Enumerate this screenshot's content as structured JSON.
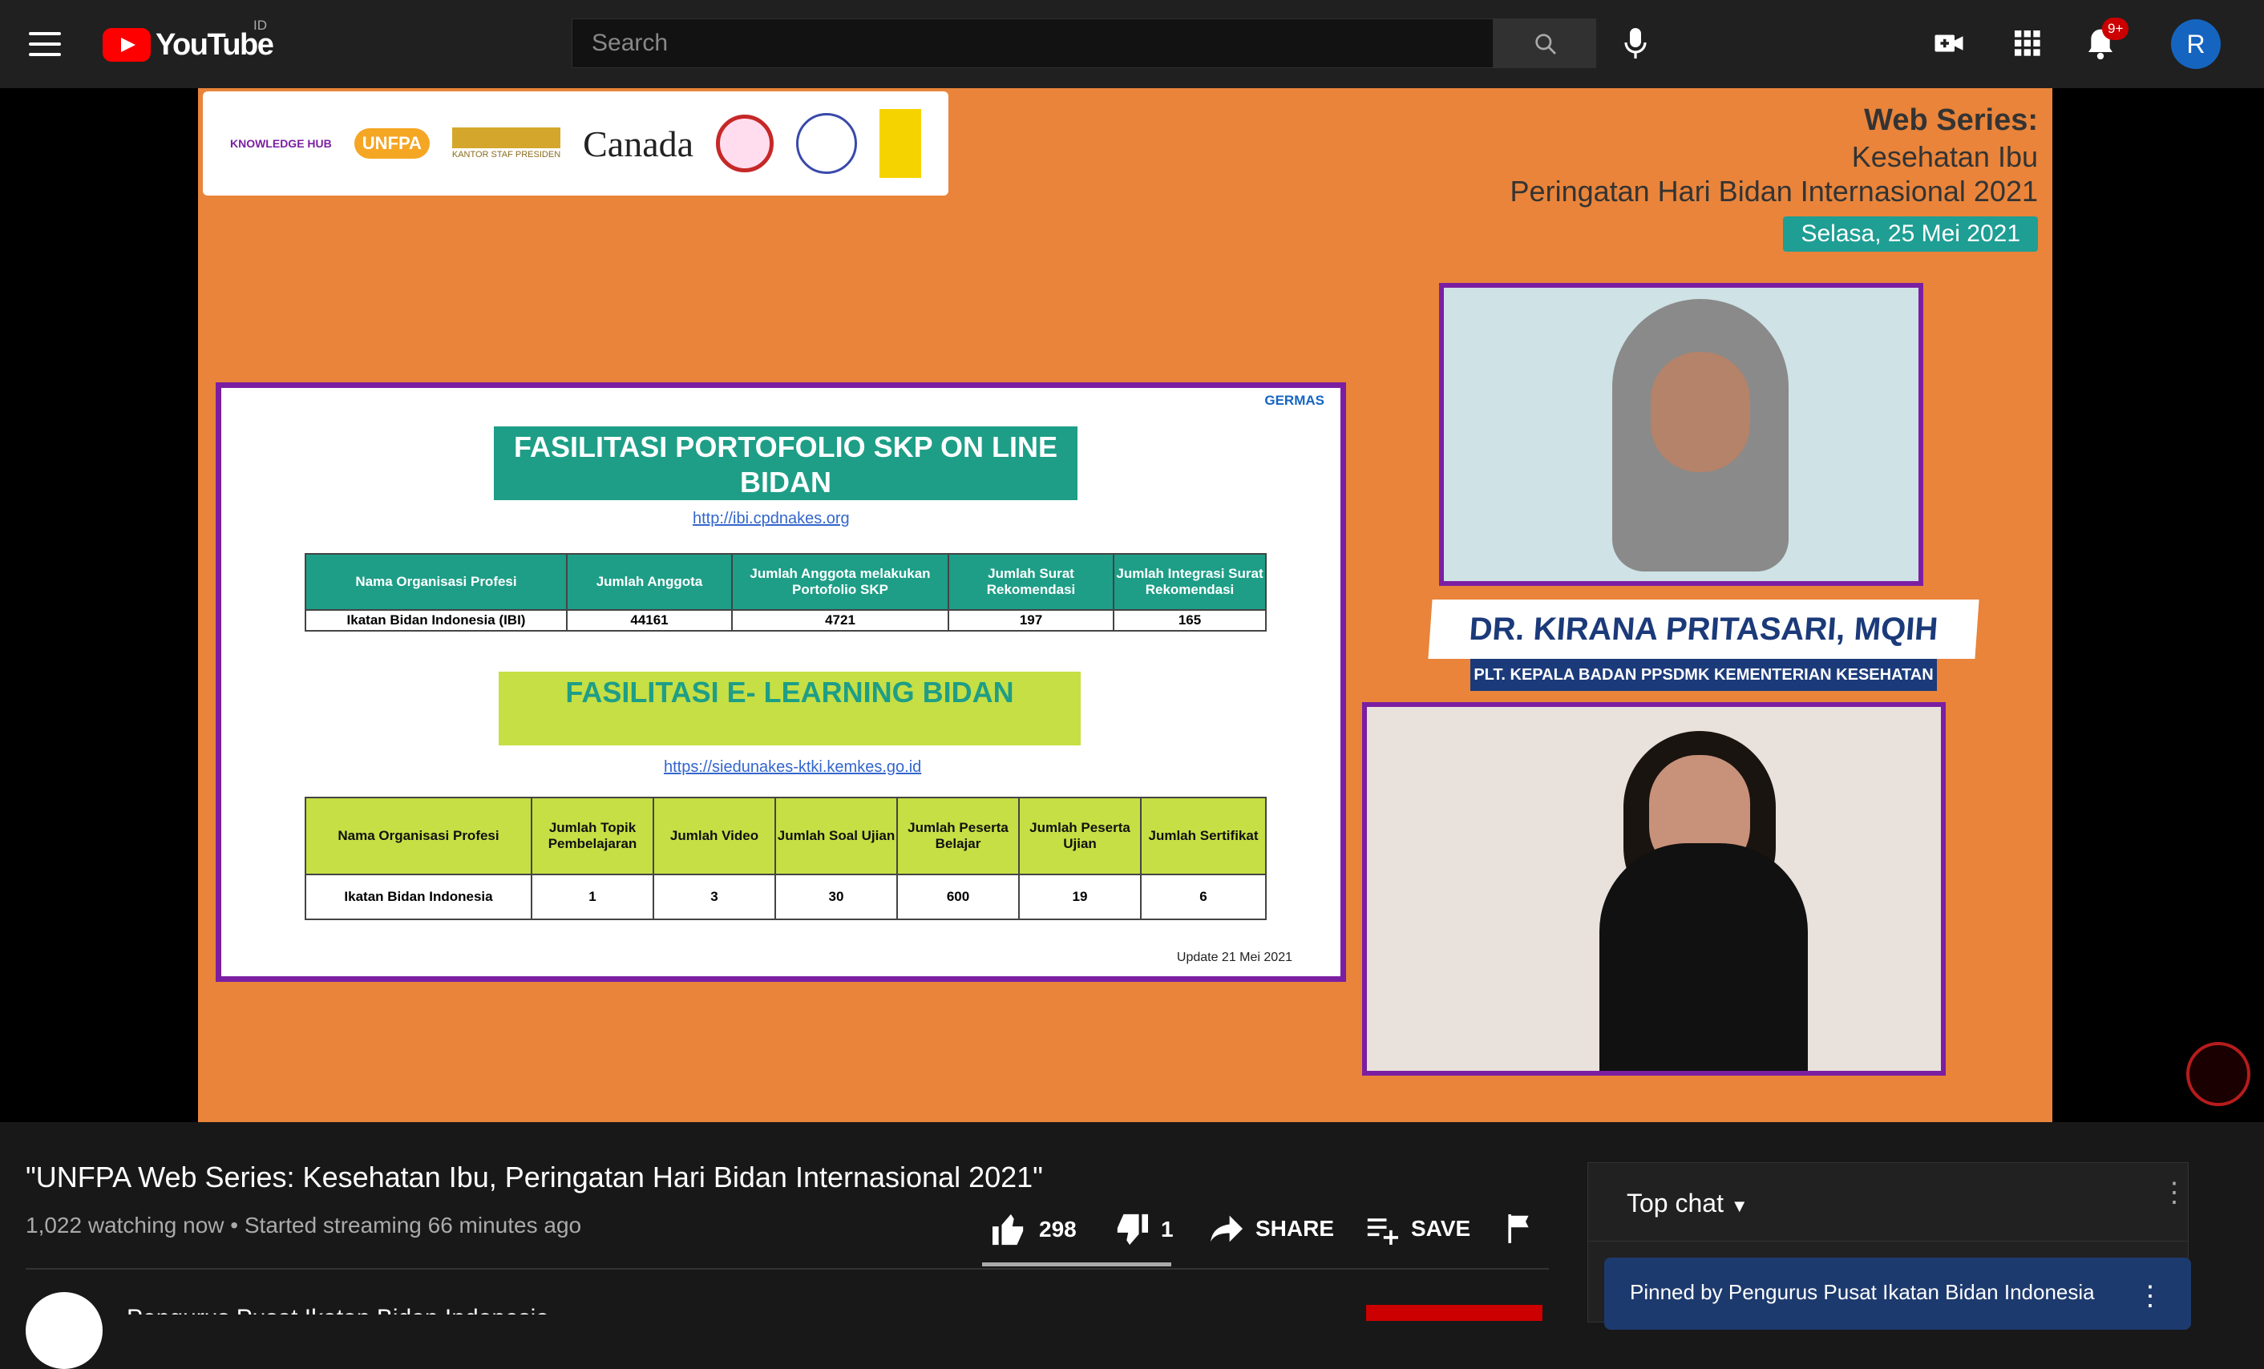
{
  "header": {
    "logo_text": "YouTube",
    "country_code": "ID",
    "search_placeholder": "Search",
    "notification_count": "9+",
    "avatar_letter": "R"
  },
  "video_frame": {
    "series_title": "Web Series:",
    "series_subtitle": "Kesehatan Ibu",
    "series_event": "Peringatan Hari Bidan Internasional 2021",
    "date": "Selasa, 25 Mei 2021",
    "partner_logos": [
      "KNOWLEDGE HUB",
      "UNFPA",
      "KANTOR STAF PRESIDEN",
      "Canada"
    ],
    "slide": {
      "heading1": "FASILITASI PORTOFOLIO SKP ON LINE BIDAN",
      "link1": "http://ibi.cpdnakes.org",
      "table1_headers": [
        "Nama Organisasi Profesi",
        "Jumlah Anggota",
        "Jumlah Anggota melakukan Portofolio SKP",
        "Jumlah Surat Rekomendasi",
        "Jumlah Integrasi Surat Rekomendasi"
      ],
      "table1_row": [
        "Ikatan Bidan Indonesia (IBI)",
        "44161",
        "4721",
        "197",
        "165"
      ],
      "heading2": "FASILITASI E- LEARNING BIDAN",
      "link2": "https://siedunakes-ktki.kemkes.go.id",
      "table2_headers": [
        "Nama Organisasi Profesi",
        "Jumlah Topik Pembelajaran",
        "Jumlah Video",
        "Jumlah Soal Ujian",
        "Jumlah Peserta Belajar",
        "Jumlah Peserta Ujian",
        "Jumlah Sertifikat"
      ],
      "table2_row": [
        "Ikatan Bidan Indonesia",
        "1",
        "3",
        "30",
        "600",
        "19",
        "6"
      ],
      "update_note": "Update 21 Mei 2021",
      "germas": "GERMAS"
    },
    "speaker_name": "DR. KIRANA PRITASARI, MQIH",
    "speaker_title": "PLT. KEPALA BADAN PPSDMK KEMENTERIAN KESEHATAN"
  },
  "video_info": {
    "title": "\"UNFPA Web Series: Kesehatan Ibu, Peringatan Hari Bidan Internasional 2021\"",
    "meta": "1,022 watching now • Started streaming 66 minutes ago",
    "likes": "298",
    "dislikes": "1",
    "share_label": "SHARE",
    "save_label": "SAVE",
    "channel_name": "Pengurus Pusat Ikatan Bidan Indonesia"
  },
  "chat": {
    "mode_label": "Top chat",
    "pinned_text": "Pinned by Pengurus Pusat Ikatan Bidan Indonesia"
  }
}
